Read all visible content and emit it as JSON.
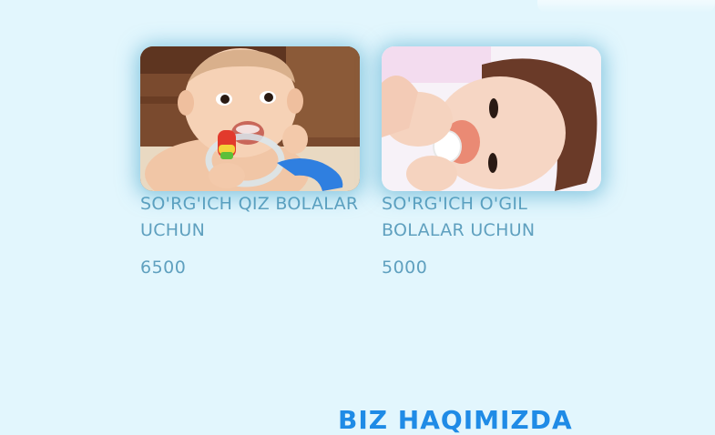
{
  "products": [
    {
      "title": "SO'RG'ICH QIZ BOLALAR UCHUN",
      "price": "6500",
      "image_icon": "baby-with-teether-photo"
    },
    {
      "title": "SO'RG'ICH O'GIL BOLALAR UCHUN",
      "price": "5000",
      "image_icon": "baby-with-pacifier-photo"
    }
  ],
  "about": {
    "heading": "BIZ HAQIMIZDA"
  },
  "colors": {
    "background": "#e2f6fd",
    "card_text": "#5fa0bf",
    "heading": "#1f8be6"
  }
}
